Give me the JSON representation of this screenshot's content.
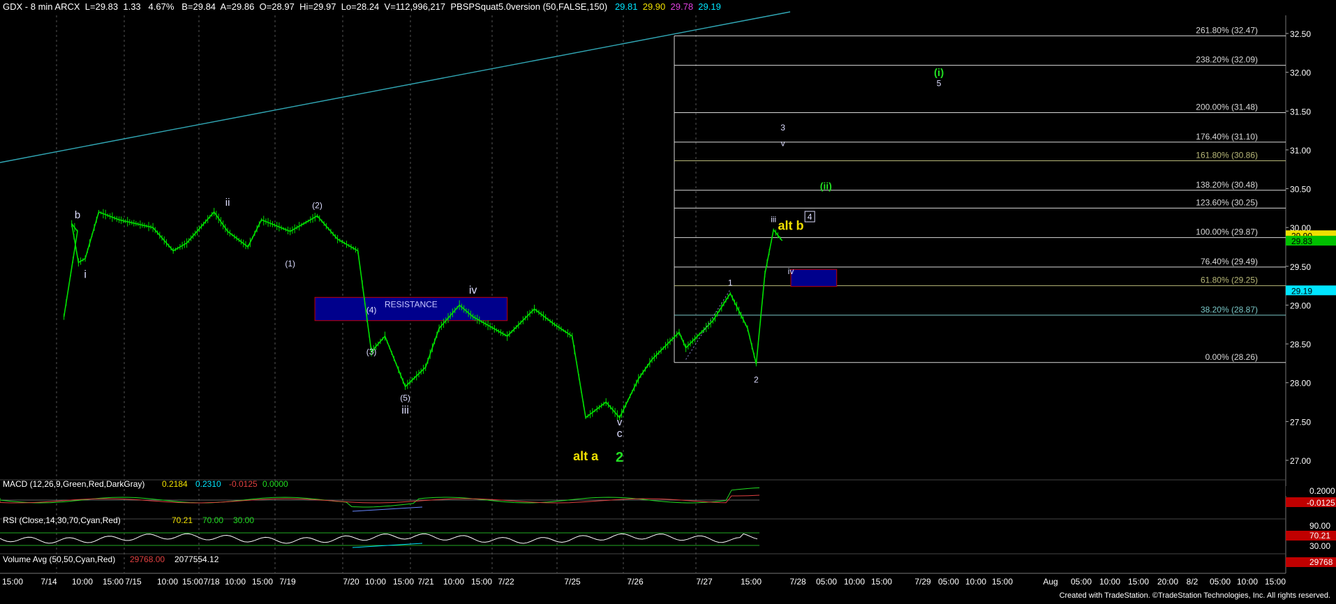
{
  "header": {
    "symbol": "GDX - 8 min  ARCX",
    "last": "L=29.83",
    "change": "1.33",
    "pct": "4.67%",
    "bid": "B=29.84",
    "ask": "A=29.86",
    "open": "O=28.97",
    "high": "Hi=29.97",
    "low": "Lo=28.24",
    "volume": "V=112,996,217",
    "indicator": "PBSPSquat5.0version (50,FALSE,150)",
    "v1": "29.81",
    "v2": "29.90",
    "v3": "29.78",
    "v4": "29.19"
  },
  "credit": "Created with TradeStation. ©TradeStation Technologies, Inc. All rights reserved.",
  "colors": {
    "background": "#000000",
    "price": "#00e000",
    "fib_line": "#d8d8d8",
    "trendline": "#31a8b6",
    "box": "#00008c",
    "box_border": "#c00000",
    "yellow": "#f0e000",
    "green": "#22dd22",
    "grid": "#555555"
  },
  "chart_data": {
    "type": "line",
    "title": "GDX - 8 min",
    "ylim": [
      26.7,
      32.7
    ],
    "y_ticks": [
      "32.50",
      "32.00",
      "31.50",
      "31.00",
      "30.50",
      "30.00",
      "29.50",
      "29.00",
      "28.50",
      "28.00",
      "27.50",
      "27.00"
    ],
    "x_ticks": [
      "15:00",
      "7/14",
      "10:00",
      "15:00",
      "7/15",
      "10:00",
      "15:00",
      "7/18",
      "10:00",
      "15:00",
      "7/19",
      "7/20",
      "10:00",
      "15:00",
      "7/21",
      "10:00",
      "15:00",
      "7/22",
      "7/25",
      "7/26",
      "7/27",
      "15:00",
      "7/28",
      "05:00",
      "10:00",
      "15:00",
      "7/29",
      "05:00",
      "10:00",
      "15:00",
      "Aug",
      "05:00",
      "10:00",
      "15:00",
      "20:00",
      "8/2",
      "05:00",
      "10:00",
      "15:00"
    ],
    "price_series": [
      [
        "7/13 15:00",
        28.85
      ],
      [
        "7/13 17:00",
        29.95
      ],
      [
        "7/14 08:00",
        30.05
      ],
      [
        "7/14 09:00",
        29.55
      ],
      [
        "7/14 10:00",
        29.6
      ],
      [
        "7/14 12:00",
        30.2
      ],
      [
        "7/14 15:00",
        30.1
      ],
      [
        "7/15 10:00",
        30.0
      ],
      [
        "7/15 13:00",
        29.7
      ],
      [
        "7/15 15:00",
        29.8
      ],
      [
        "7/18 08:00",
        30.2
      ],
      [
        "7/18 10:00",
        29.95
      ],
      [
        "7/18 13:00",
        29.75
      ],
      [
        "7/18 15:00",
        30.1
      ],
      [
        "7/19 08:00",
        29.95
      ],
      [
        "7/19 12:00",
        30.15
      ],
      [
        "7/19 15:00",
        29.85
      ],
      [
        "7/20 08:00",
        29.7
      ],
      [
        "7/20 10:00",
        28.4
      ],
      [
        "7/20 12:00",
        28.6
      ],
      [
        "7/20 15:00",
        27.95
      ],
      [
        "7/21 08:00",
        28.2
      ],
      [
        "7/21 10:00",
        28.7
      ],
      [
        "7/21 13:00",
        29.0
      ],
      [
        "7/21 15:00",
        28.85
      ],
      [
        "7/22 08:00",
        28.6
      ],
      [
        "7/22 12:00",
        28.95
      ],
      [
        "7/22 15:00",
        28.75
      ],
      [
        "7/25 08:00",
        28.6
      ],
      [
        "7/25 10:00",
        27.55
      ],
      [
        "7/25 13:00",
        27.75
      ],
      [
        "7/25 15:00",
        27.55
      ],
      [
        "7/26 08:00",
        28.05
      ],
      [
        "7/26 10:00",
        28.3
      ],
      [
        "7/26 14:00",
        28.65
      ],
      [
        "7/26 15:00",
        28.45
      ],
      [
        "7/27 08:00",
        28.8
      ],
      [
        "7/27 10:00",
        29.15
      ],
      [
        "7/27 12:00",
        28.7
      ],
      [
        "7/27 13:00",
        28.24
      ],
      [
        "7/27 14:00",
        29.4
      ],
      [
        "7/27 15:00",
        29.97
      ],
      [
        "7/27 16:00",
        29.83
      ]
    ],
    "fib_levels": [
      {
        "label": "261.80% (32.47)",
        "value": 32.47
      },
      {
        "label": "238.20% (32.09)",
        "value": 32.09
      },
      {
        "label": "200.00% (31.48)",
        "value": 31.48
      },
      {
        "label": "176.40% (31.10)",
        "value": 31.1
      },
      {
        "label": "161.80% (30.86)",
        "value": 30.86
      },
      {
        "label": "138.20% (30.48)",
        "value": 30.48
      },
      {
        "label": "123.60% (30.25)",
        "value": 30.25
      },
      {
        "label": "100.00% (29.87)",
        "value": 29.87
      },
      {
        "label": "76.40% (29.49)",
        "value": 29.49
      },
      {
        "label": "61.80% (29.25)",
        "value": 29.25
      },
      {
        "label": "38.20% (28.87)",
        "value": 28.87
      },
      {
        "label": "0.00% (28.26)",
        "value": 28.26
      }
    ],
    "price_badges": [
      {
        "text": "29.90",
        "value": 29.9,
        "bg": "#f0e000",
        "fg": "#000000"
      },
      {
        "text": "29.83",
        "value": 29.83,
        "bg": "#00c000",
        "fg": "#000000"
      },
      {
        "text": "29.19",
        "value": 29.19,
        "bg": "#00e5ff",
        "fg": "#000000"
      }
    ],
    "wave_labels": [
      {
        "text": "b",
        "x": "7/13 17:00",
        "y": 30.12,
        "color": "#dcdcff",
        "size": 15
      },
      {
        "text": "i",
        "x": "7/14 10:00",
        "y": 29.35,
        "color": "#dcdcff",
        "size": 16
      },
      {
        "text": "ii",
        "x": "7/18 10:00",
        "y": 30.28,
        "color": "#dcdcff",
        "size": 15
      },
      {
        "text": "(1)",
        "x": "7/19 08:00",
        "y": 29.5,
        "color": "#dcdcff",
        "size": 12
      },
      {
        "text": "(2)",
        "x": "7/19 12:00",
        "y": 30.25,
        "color": "#dcdcff",
        "size": 12
      },
      {
        "text": "(3)",
        "x": "7/20 10:00",
        "y": 28.36,
        "color": "#dcdcff",
        "size": 12
      },
      {
        "text": "(4)",
        "x": "7/20 10:00",
        "y": 28.9,
        "color": "#dcdcff",
        "size": 12
      },
      {
        "text": "(5)",
        "x": "7/20 15:00",
        "y": 27.77,
        "color": "#dcdcff",
        "size": 12
      },
      {
        "text": "iii",
        "x": "7/20 15:00",
        "y": 27.6,
        "color": "#dcdcff",
        "size": 16
      },
      {
        "text": "iv",
        "x": "7/21 15:00",
        "y": 29.15,
        "color": "#dcdcff",
        "size": 16
      },
      {
        "text": "alt a",
        "x": "7/25 10:00",
        "y": 27.0,
        "color": "#f0e000",
        "size": 18
      },
      {
        "text": "v",
        "x": "7/25 15:00",
        "y": 27.45,
        "color": "#dcdcff",
        "size": 15
      },
      {
        "text": "c",
        "x": "7/25 15:00",
        "y": 27.3,
        "color": "#dcdcff",
        "size": 16
      },
      {
        "text": "2",
        "x": "7/25 15:00",
        "y": 26.98,
        "color": "#22dd22",
        "size": 20
      },
      {
        "text": "1",
        "x": "7/27 10:00",
        "y": 29.25,
        "color": "#dcdcff",
        "size": 12
      },
      {
        "text": "2",
        "x": "7/27 13:00",
        "y": 28.0,
        "color": "#dcdcff",
        "size": 12
      },
      {
        "text": "iii",
        "x": "7/27 15:00",
        "y": 30.07,
        "color": "#dcdcff",
        "size": 12
      },
      {
        "text": "alt b",
        "x": "7/27 17:00",
        "y": 29.97,
        "color": "#f0e000",
        "size": 18
      },
      {
        "text": "iv",
        "x": "7/27 17:00",
        "y": 29.4,
        "color": "#dcdcff",
        "size": 12
      },
      {
        "text": "3",
        "x": "7/28 05:00",
        "y": 31.25,
        "color": "#dcdcff",
        "size": 12
      },
      {
        "text": "v",
        "x": "7/28 05:00",
        "y": 31.05,
        "color": "#dcdcff",
        "size": 12
      },
      {
        "text": "(ii)",
        "x": "7/28 13:00",
        "y": 30.49,
        "color": "#22dd22",
        "size": 14
      },
      {
        "text": "4",
        "x": "7/28 10:00",
        "y": 30.1,
        "color": "#dcdcff",
        "size": 12
      },
      {
        "text": "(i)",
        "x": "7/29 10:00",
        "y": 31.95,
        "color": "#22dd22",
        "size": 15
      },
      {
        "text": "5",
        "x": "7/29 10:00",
        "y": 31.82,
        "color": "#dcdcff",
        "size": 12
      }
    ],
    "boxes": [
      {
        "label": "RESISTANCE",
        "x0": "7/20 10:00",
        "x1": "7/22 08:00",
        "y0": 28.8,
        "y1": 29.1
      },
      {
        "label": "",
        "x0": "7/27 17:00",
        "x1": "7/28 15:00",
        "y0": 29.24,
        "y1": 29.46
      }
    ],
    "macd": {
      "label": "MACD (12,26,9,Green,Red,DarkGray)",
      "values": [
        "0.2184",
        "0.2310",
        "-0.0125",
        "0.0000"
      ],
      "axis": [
        "0.2000",
        "-0.0125"
      ]
    },
    "rsi": {
      "label": "RSI (Close,14,30,70,Cyan,Red)",
      "values": [
        "70.21",
        "70.00",
        "30.00"
      ],
      "axis": [
        "30.00",
        "70.21",
        "90.00"
      ]
    },
    "volume": {
      "label": "Volume Avg (50,50,Cyan,Red)",
      "values": [
        "29768.00",
        "2077554.12"
      ],
      "axis": [
        "29768"
      ]
    }
  }
}
